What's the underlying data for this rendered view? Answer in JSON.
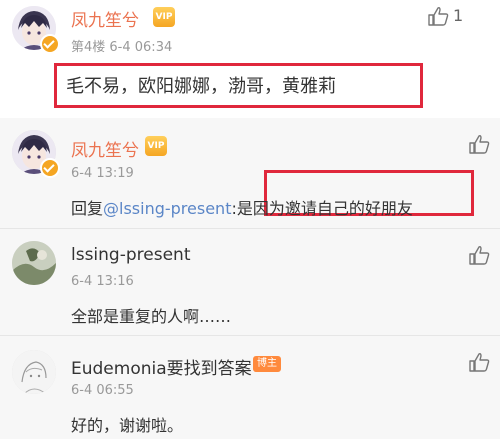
{
  "main_comment": {
    "author": "凤九笙兮",
    "floor_time": "第4楼  6-4 06:34",
    "text": "毛不易，欧阳娜娜，渤哥，黄雅莉",
    "likes": "1"
  },
  "replies": [
    {
      "author": "凤九笙兮",
      "time": "6-4 13:19",
      "reply_prefix": "回复",
      "mention": "@lssing-present",
      "text": ":是因为邀请自己的好朋友"
    },
    {
      "author": "lssing-present",
      "time": "6-4 13:16",
      "text": "全部是重复的人啊……"
    },
    {
      "author": "Eudemonia要找到答案",
      "badge": "博主",
      "time": "6-4 06:55",
      "text": "好的，谢谢啦。"
    }
  ],
  "colors": {
    "name_accent": "#eb7350",
    "highlight_box": "#e0283c",
    "mention_link": "#5b86c7",
    "reply_bg": "#f7f7f7"
  },
  "icons": [
    "thumb-up-icon",
    "verified-icon",
    "vip-badge-icon"
  ]
}
